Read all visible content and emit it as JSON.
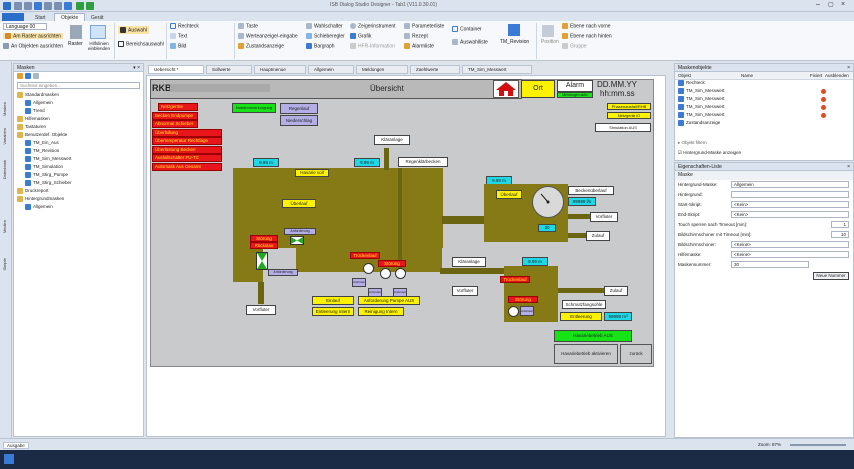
{
  "window": {
    "title": "ISB Dialog Studio Designer - Tab1 (V11.0.30.01)"
  },
  "tabs": [
    "Start",
    "Objekte",
    "Gerät"
  ],
  "ribbon": {
    "language": "Language 00",
    "align_grid": "Am Raster ausrichten",
    "align_objects": "An Objekten ausrichten",
    "grid": "Raster",
    "helplines": "Hilfslinien einblenden",
    "auswahl": "Auswahl",
    "bereichsauswahl": "Bereichsauswahl",
    "group_anzeige": "Anzeige",
    "draw_items": [
      "Rechteck",
      "Text",
      "Bild"
    ],
    "ctrl_col1": [
      "Taste",
      "Werteanzeige/-eingabe",
      "Zustandsanzeige"
    ],
    "ctrl_col2": [
      "Wahlschalter",
      "Schieberegler",
      "Bargraph"
    ],
    "ctrl_col3": [
      "Zeigerinstrument",
      "Grafik",
      "HFR-Information"
    ],
    "ctrl_col4": [
      "Parameterliste",
      "Rezept",
      "Alarmliste"
    ],
    "container": "Container",
    "auswahlliste": "Auswahlliste",
    "tm_revision": "TM_Revision",
    "group_objekte": "Objekte",
    "position": "Position",
    "order": [
      "Ebene nach vorne",
      "Ebene nach hinten",
      "Gruppe"
    ],
    "group_anordnen": "Anordnen"
  },
  "left_rail": [
    "Masken",
    "Variablen",
    "Datenbank",
    "Medien",
    "Skripte"
  ],
  "masks_panel": {
    "title": "Masken",
    "search_placeholder": "Suchtext eingeben...",
    "tree": [
      {
        "label": "Standardmasken",
        "level": 0
      },
      {
        "label": "Allgemein",
        "level": 1
      },
      {
        "label": "Trend",
        "level": 1
      },
      {
        "label": "Hilfemasken",
        "level": 0
      },
      {
        "label": "Tastaturen",
        "level": 0
      },
      {
        "label": "Benutzerdef. Objekte",
        "level": 0
      },
      {
        "label": "TM_Ein_Aus",
        "level": 1
      },
      {
        "label": "TM_Revision",
        "level": 1
      },
      {
        "label": "TM_Sim_Messwert",
        "level": 1
      },
      {
        "label": "TM_Simulation",
        "level": 1
      },
      {
        "label": "TM_Stirg_Pumpe",
        "level": 1
      },
      {
        "label": "TM_Stirg_Schieber",
        "level": 1
      },
      {
        "label": "Druckreport",
        "level": 0
      },
      {
        "label": "Hintergrundmasken",
        "level": 0
      },
      {
        "label": "Allgemein",
        "level": 1
      }
    ]
  },
  "doc_tabs": [
    "Uebersicht *",
    "Sollwerte",
    "Hauptmenue",
    "Allgemein",
    "Meldungen",
    "Zaehlwerte",
    "TM_Sim_Messwert"
  ],
  "scada": {
    "rkb": "RKB",
    "title": "Übersicht",
    "ort": "Ort",
    "alarm": "Alarm",
    "alarm_sub": "Meldungen aktiv",
    "datetime1": "DD.MM.YY",
    "datetime2": "hh:mm.ss",
    "phasen": "Phasenausfall/RHB",
    "netzgeraet": "Netzgerät iO",
    "simulation": "Simulation AUS",
    "left_alarms": [
      "Netzgeräte",
      "Becken Endpumpe",
      "Abnormal Schieber",
      "Überfüllung",
      "Übertemperatur Rechtlage",
      "Überlastung Becken",
      "Ausfallschalter FU-TC",
      "Automatik Aus Gesamt"
    ],
    "notstrom": "Notstromversorgung",
    "regenlauf": "Regenlauf",
    "niederschlag": "Niederschlag",
    "klaeranlage": "Kläranlage",
    "regenklaerbecken": "Regenklärbecken",
    "level1": "9.99 m",
    "level2": "9.99 m",
    "level3": "9.99 m",
    "level4": "9.99 m",
    "havarie": "Havarie voll",
    "ueberlauf1": "Überlauf",
    "ueberlauf2": "Überlauf",
    "stoerung": "Störung",
    "rueckstau": "Rückstau",
    "vorfluter": "Vorfluter",
    "zulauf": "Zulauf",
    "zulauf2": "Zulauf",
    "beckenueberlauf": "Beckenüberlauf",
    "flow1": "99999 l/s",
    "gauge_val": "30",
    "klaeranlage2": "Kläranlage",
    "vorfluter2": "Vorfluter",
    "vorfluter3": "Vorfluter",
    "trockenlauf": "Trockenlauf",
    "trockenlauf2": "Trockenlauf",
    "einlauf": "Einlauf",
    "entleerung_intern": "Entleerung Intern",
    "anforderung": "Anforderung Pumpe AUS",
    "reinigung": "Reinigung Intern",
    "schmutzfangsohle": "Schmutzfangsohle",
    "entleerung": "Entleerung",
    "flow2": "99999 m³",
    "havarie_aus": "Havariebetrieb AUS",
    "havarie_btn": "Havariebetrieb aktivieren",
    "zurueck": "zurück",
    "small": "Anforderung"
  },
  "objects_panel": {
    "title": "Maskenobjekte",
    "cols": [
      "Objekt",
      "Name",
      "Fixiert",
      "Ausblenden"
    ],
    "rows": [
      "Rechteck",
      "TM_Sim_Messwert",
      "TM_Sim_Messwert",
      "TM_Sim_Messwert",
      "TM_Sim_Messwert",
      "Zustandsanzeige"
    ],
    "filter": "Objekt filtern",
    "show_bg": "Hintergrund-Maske anzeigen"
  },
  "props_panel": {
    "title": "Eigenschaften-Liste",
    "section": "Maske",
    "rows": [
      {
        "label": "Hintergrund-Maske:",
        "value": "Allgemein"
      },
      {
        "label": "Hintergrund:",
        "value": ""
      },
      {
        "label": "Start-Skript:",
        "value": "<Kein>"
      },
      {
        "label": "End-Skript:",
        "value": "<Kein>"
      },
      {
        "label": "Touch sperren nach Timeout [min]:",
        "value": "1"
      },
      {
        "label": "Bildschirmschoner mit Timeout [min]:",
        "value": "10"
      },
      {
        "label": "Bildschirmschoner:",
        "value": "<Keine>"
      },
      {
        "label": "Hilfemaske:",
        "value": "<Keine>"
      },
      {
        "label": "Maskennummer:",
        "value": "30"
      }
    ],
    "new_number": "Neue Nummer"
  },
  "status": {
    "output": "Ausgabe",
    "zoom": "Zoom: 87%"
  }
}
